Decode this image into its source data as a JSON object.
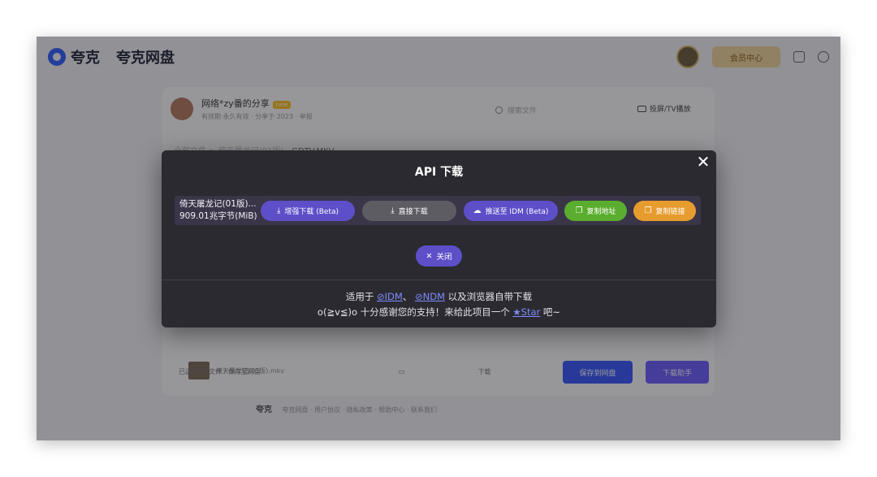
{
  "page": {
    "logo_text": "夸克",
    "logo_sub": "夸克网盘",
    "vip_label": "会员中心",
    "share_title": "网络*zy番的分享",
    "share_badge": "new",
    "share_meta": "有效期·永久有效 · 分享于 2023 · 举报",
    "search_placeholder": "搜索文件",
    "tv_label": "投屏/TV播放",
    "crumb_all": "全部文件 > 倚天屠龙记(01版)",
    "crumb_current": "GDTV.MKV...",
    "row_text": "倚天屠龙记(01版).mkv",
    "bottom_text": "已选中1个文件 / 保存至网盘",
    "download_label": "下载",
    "save_button": "保存到网盘",
    "download_button": "下载助手",
    "footer_brand": "夸克",
    "footer_text": "夸克网盘 · 用户协议 · 隐私政策 · 帮助中心 · 联系我们"
  },
  "modal": {
    "title": "API 下载",
    "file_name": "倚天屠龙记(01版)...",
    "file_size": "909.01兆字节(MiB)",
    "buttons": {
      "enhanced_download": "增强下载 (Beta)",
      "direct_download": "直接下载",
      "push_idm": "推送至 IDM (Beta)",
      "copy_link_1": "复制地址",
      "copy_link_2": "复制链接"
    },
    "close_label": "关闭",
    "footer": {
      "prefix": "适用于",
      "idm": "IDM",
      "sep": "、",
      "ndm": "NDM",
      "suffix": "以及浏览器自带下载",
      "thanks": "o(≧v≦)o 十分感谢您的支持！来给此项目一个",
      "star": "Star",
      "end": "吧~"
    }
  },
  "colors": {
    "modal_bg": "#2b2a30",
    "accent_purple": "#5d4fc8",
    "green": "#5aad2e",
    "orange": "#e79c2e",
    "link": "#7f8cff"
  }
}
